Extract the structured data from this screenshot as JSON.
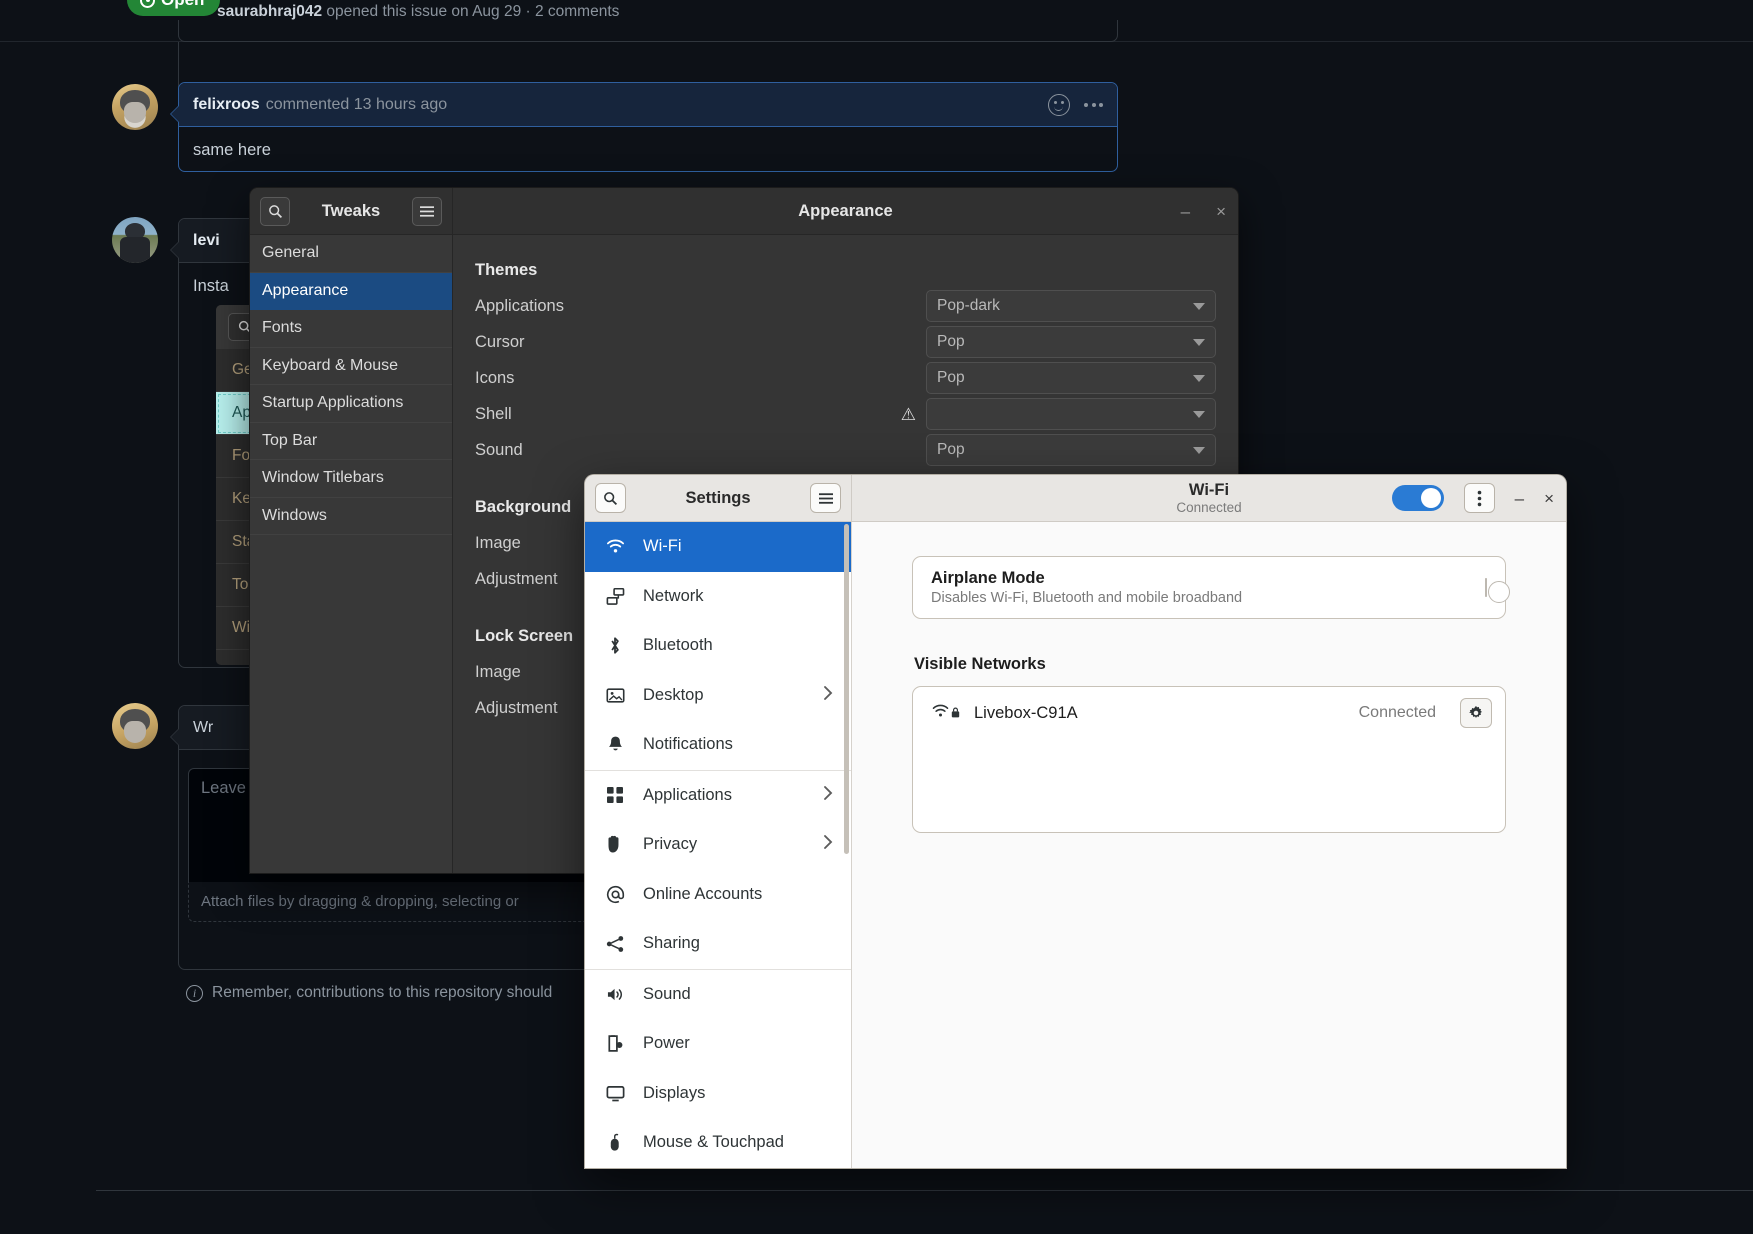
{
  "github": {
    "status_badge": "Open",
    "issue_meta_author": "saurabhraj042",
    "issue_meta_rest": " opened this issue on Aug 29 · 2 comments",
    "comments": [
      {
        "author": "felixroos",
        "meta": "commented 13 hours ago",
        "body": "same here"
      },
      {
        "author": "levi",
        "meta": "",
        "body": "Insta"
      }
    ],
    "embedded_shot": {
      "items": [
        "Ge",
        "Ap",
        "Fo",
        "Key",
        "Sta",
        "Top",
        "Wi"
      ]
    },
    "write_tab_label": "Wr",
    "comment_placeholder": "Leave a comment",
    "attach_text": "Attach files by dragging & dropping, selecting or",
    "remember_note": "Remember, contributions to this repository should",
    "info_icon": "info-icon"
  },
  "tweaks": {
    "window_title_left": "Tweaks",
    "window_title_right": "Appearance",
    "search_icon": "search-icon",
    "menu_icon": "hamburger-menu-icon",
    "minimize_label": "–",
    "close_label": "×",
    "sidebar": [
      {
        "label": "General",
        "active": false
      },
      {
        "label": "Appearance",
        "active": true
      },
      {
        "label": "Fonts",
        "active": false
      },
      {
        "label": "Keyboard & Mouse",
        "active": false
      },
      {
        "label": "Startup Applications",
        "active": false
      },
      {
        "label": "Top Bar",
        "active": false
      },
      {
        "label": "Window Titlebars",
        "active": false
      },
      {
        "label": "Windows",
        "active": false
      }
    ],
    "groups": [
      {
        "title": "Themes",
        "rows": [
          {
            "label": "Applications",
            "value": "Pop-dark",
            "warn": false
          },
          {
            "label": "Cursor",
            "value": "Pop",
            "warn": false
          },
          {
            "label": "Icons",
            "value": "Pop",
            "warn": false
          },
          {
            "label": "Shell",
            "value": "",
            "warn": true
          },
          {
            "label": "Sound",
            "value": "Pop",
            "warn": false
          }
        ]
      },
      {
        "title": "Background",
        "rows": [
          {
            "label": "Image",
            "value": "",
            "warn": false
          },
          {
            "label": "Adjustment",
            "value": "",
            "warn": false
          }
        ]
      },
      {
        "title": "Lock Screen",
        "rows": [
          {
            "label": "Image",
            "value": "",
            "warn": false
          },
          {
            "label": "Adjustment",
            "value": "",
            "warn": false
          }
        ]
      }
    ]
  },
  "settings": {
    "window_title_left": "Settings",
    "panel_title": "Wi-Fi",
    "panel_subtitle": "Connected",
    "search_icon": "search-icon",
    "menu_icon": "hamburger-menu-icon",
    "wifi_toggle": "on",
    "more_icon": "vertical-dots-icon",
    "minimize_label": "–",
    "close_label": "×",
    "accent_color": "#1b6ac9",
    "sidebar": [
      {
        "label": "Wi-Fi",
        "icon": "wifi-icon",
        "active": true,
        "chevron": false
      },
      {
        "label": "Network",
        "icon": "network-icon",
        "active": false,
        "chevron": false
      },
      {
        "label": "Bluetooth",
        "icon": "bluetooth-icon",
        "active": false,
        "chevron": false
      },
      {
        "label": "Desktop",
        "icon": "desktop-image-icon",
        "active": false,
        "chevron": true
      },
      {
        "label": "Notifications",
        "icon": "bell-icon",
        "active": false,
        "chevron": false
      },
      {
        "label": "Applications",
        "icon": "grid-apps-icon",
        "active": false,
        "chevron": true,
        "sep_before": true
      },
      {
        "label": "Privacy",
        "icon": "hand-icon",
        "active": false,
        "chevron": true
      },
      {
        "label": "Online Accounts",
        "icon": "at-sign-icon",
        "active": false,
        "chevron": false
      },
      {
        "label": "Sharing",
        "icon": "share-icon",
        "active": false,
        "chevron": false
      },
      {
        "label": "Sound",
        "icon": "speaker-icon",
        "active": false,
        "chevron": false,
        "sep_before": true
      },
      {
        "label": "Power",
        "icon": "battery-icon",
        "active": false,
        "chevron": false
      },
      {
        "label": "Displays",
        "icon": "monitor-icon",
        "active": false,
        "chevron": false
      },
      {
        "label": "Mouse & Touchpad",
        "icon": "mouse-icon",
        "active": false,
        "chevron": false
      }
    ],
    "airplane_mode": {
      "title": "Airplane Mode",
      "description": "Disables Wi-Fi, Bluetooth and mobile broadband",
      "toggle": "off"
    },
    "visible_networks_title": "Visible Networks",
    "networks": [
      {
        "name": "Livebox-C91A",
        "status": "Connected",
        "secured": true,
        "gear_icon": "gear-icon"
      }
    ]
  }
}
